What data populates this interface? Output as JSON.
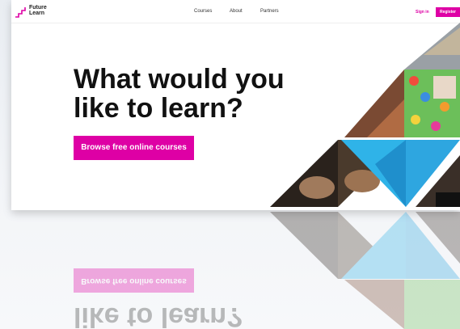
{
  "header": {
    "logo_text": "Future Learn",
    "nav": [
      "Courses",
      "About",
      "Partners"
    ],
    "sign_in": "Sign in",
    "register": "Register"
  },
  "hero": {
    "title": "What would you like to learn?",
    "cta": "Browse free online courses"
  },
  "colors": {
    "accent": "#de00a5"
  }
}
